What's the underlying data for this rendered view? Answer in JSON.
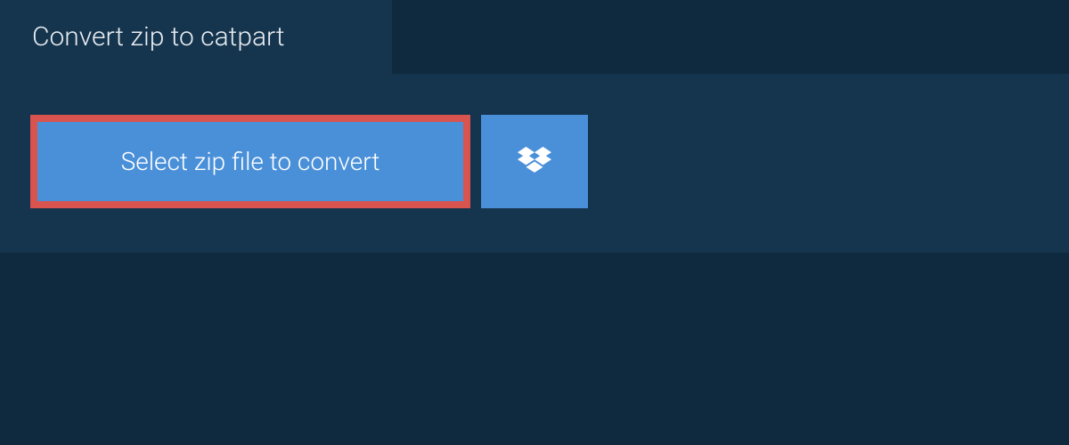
{
  "tab": {
    "title": "Convert zip to catpart"
  },
  "panel": {
    "select_button_label": "Select zip file to convert"
  }
}
